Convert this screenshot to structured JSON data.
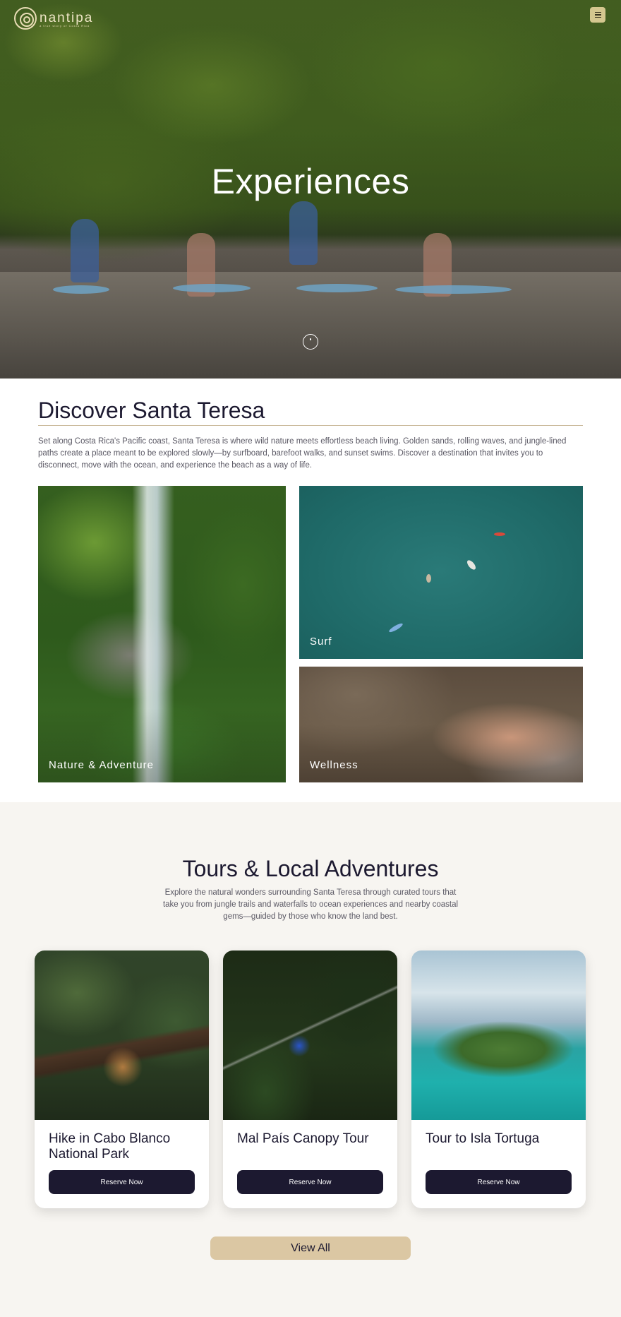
{
  "header": {
    "logo_text": "nantipa",
    "logo_sub": "a true story of Costa Rica",
    "menu_icon": "hamburger-icon"
  },
  "hero": {
    "title": "Experiences",
    "scroll_icon": "scroll-down-icon"
  },
  "discover": {
    "title": "Discover Santa Teresa",
    "text": "Set along Costa Rica's Pacific coast, Santa Teresa is where wild nature meets effortless beach living. Golden sands, rolling waves, and jungle-lined paths create a place meant to be explored slowly—by surfboard, barefoot walks, and sunset swims. Discover a destination that invites you to disconnect, move with the ocean, and experience the beach as a way of life.",
    "tiles": [
      {
        "label": "Nature & Adventure"
      },
      {
        "label": "Surf"
      },
      {
        "label": "Wellness"
      }
    ]
  },
  "tours": {
    "title": "Tours & Local Adventures",
    "text": "Explore the natural wonders surrounding Santa Teresa through curated tours that take you from jungle trails and waterfalls to ocean experiences and nearby coastal gems—guided by those who know the land best.",
    "cards": [
      {
        "title": "Hike in Cabo Blanco National Park",
        "button": "Reserve Now"
      },
      {
        "title": "Mal País Canopy Tour",
        "button": "Reserve Now"
      },
      {
        "title": "Tour to Isla Tortuga",
        "button": "Reserve Now"
      }
    ],
    "view_all": "View All"
  },
  "colors": {
    "primary": "#1c1930",
    "accent": "#dbc7a3",
    "menu_button": "#d4c78f",
    "section_bg": "#f7f5f1"
  }
}
